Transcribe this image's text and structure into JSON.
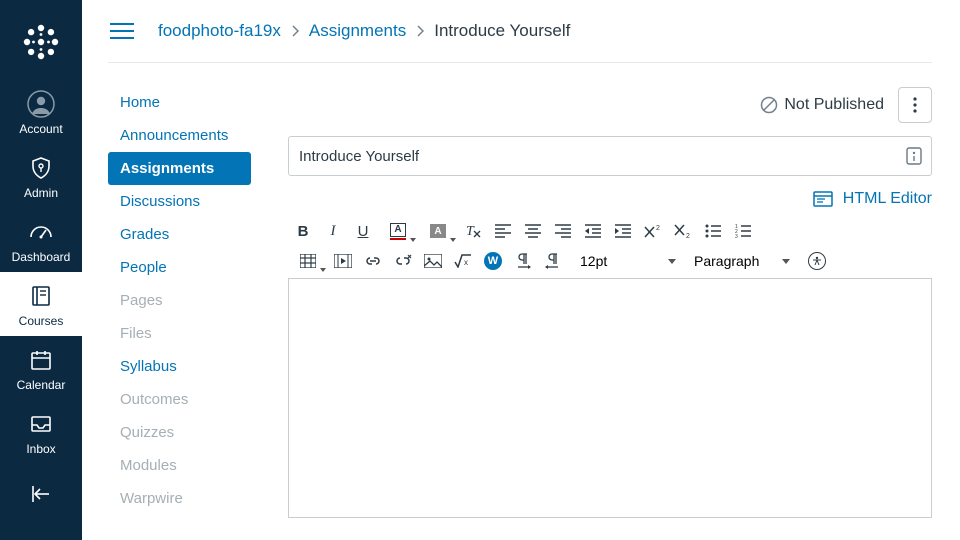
{
  "global_nav": {
    "items": [
      {
        "label": "Account"
      },
      {
        "label": "Admin"
      },
      {
        "label": "Dashboard"
      },
      {
        "label": "Courses"
      },
      {
        "label": "Calendar"
      },
      {
        "label": "Inbox"
      }
    ]
  },
  "breadcrumb": {
    "course": "foodphoto-fa19x",
    "section": "Assignments",
    "page": "Introduce Yourself"
  },
  "course_nav": {
    "items": [
      {
        "label": "Home"
      },
      {
        "label": "Announcements"
      },
      {
        "label": "Assignments"
      },
      {
        "label": "Discussions"
      },
      {
        "label": "Grades"
      },
      {
        "label": "People"
      },
      {
        "label": "Pages"
      },
      {
        "label": "Files"
      },
      {
        "label": "Syllabus"
      },
      {
        "label": "Outcomes"
      },
      {
        "label": "Quizzes"
      },
      {
        "label": "Modules"
      },
      {
        "label": "Warpwire"
      }
    ]
  },
  "status": {
    "not_published": "Not Published"
  },
  "form": {
    "title_value": "Introduce Yourself",
    "html_editor": "HTML Editor"
  },
  "toolbar": {
    "font_size": "12pt",
    "block_format": "Paragraph"
  },
  "colors": {
    "brand": "#0b2a42",
    "link": "#0374b5"
  }
}
